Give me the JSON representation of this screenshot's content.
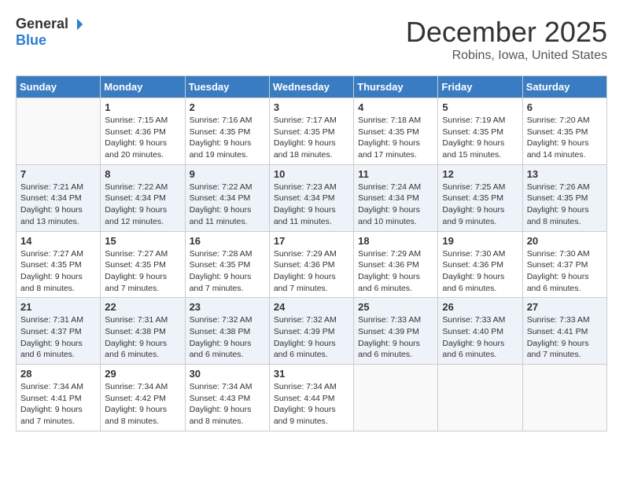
{
  "header": {
    "logo_general": "General",
    "logo_blue": "Blue",
    "month_title": "December 2025",
    "subtitle": "Robins, Iowa, United States"
  },
  "days_of_week": [
    "Sunday",
    "Monday",
    "Tuesday",
    "Wednesday",
    "Thursday",
    "Friday",
    "Saturday"
  ],
  "weeks": [
    [
      {
        "day": "",
        "empty": true
      },
      {
        "day": "1",
        "sunrise": "Sunrise: 7:15 AM",
        "sunset": "Sunset: 4:36 PM",
        "daylight": "Daylight: 9 hours and 20 minutes."
      },
      {
        "day": "2",
        "sunrise": "Sunrise: 7:16 AM",
        "sunset": "Sunset: 4:35 PM",
        "daylight": "Daylight: 9 hours and 19 minutes."
      },
      {
        "day": "3",
        "sunrise": "Sunrise: 7:17 AM",
        "sunset": "Sunset: 4:35 PM",
        "daylight": "Daylight: 9 hours and 18 minutes."
      },
      {
        "day": "4",
        "sunrise": "Sunrise: 7:18 AM",
        "sunset": "Sunset: 4:35 PM",
        "daylight": "Daylight: 9 hours and 17 minutes."
      },
      {
        "day": "5",
        "sunrise": "Sunrise: 7:19 AM",
        "sunset": "Sunset: 4:35 PM",
        "daylight": "Daylight: 9 hours and 15 minutes."
      },
      {
        "day": "6",
        "sunrise": "Sunrise: 7:20 AM",
        "sunset": "Sunset: 4:35 PM",
        "daylight": "Daylight: 9 hours and 14 minutes."
      }
    ],
    [
      {
        "day": "7",
        "sunrise": "Sunrise: 7:21 AM",
        "sunset": "Sunset: 4:34 PM",
        "daylight": "Daylight: 9 hours and 13 minutes."
      },
      {
        "day": "8",
        "sunrise": "Sunrise: 7:22 AM",
        "sunset": "Sunset: 4:34 PM",
        "daylight": "Daylight: 9 hours and 12 minutes."
      },
      {
        "day": "9",
        "sunrise": "Sunrise: 7:22 AM",
        "sunset": "Sunset: 4:34 PM",
        "daylight": "Daylight: 9 hours and 11 minutes."
      },
      {
        "day": "10",
        "sunrise": "Sunrise: 7:23 AM",
        "sunset": "Sunset: 4:34 PM",
        "daylight": "Daylight: 9 hours and 11 minutes."
      },
      {
        "day": "11",
        "sunrise": "Sunrise: 7:24 AM",
        "sunset": "Sunset: 4:34 PM",
        "daylight": "Daylight: 9 hours and 10 minutes."
      },
      {
        "day": "12",
        "sunrise": "Sunrise: 7:25 AM",
        "sunset": "Sunset: 4:35 PM",
        "daylight": "Daylight: 9 hours and 9 minutes."
      },
      {
        "day": "13",
        "sunrise": "Sunrise: 7:26 AM",
        "sunset": "Sunset: 4:35 PM",
        "daylight": "Daylight: 9 hours and 8 minutes."
      }
    ],
    [
      {
        "day": "14",
        "sunrise": "Sunrise: 7:27 AM",
        "sunset": "Sunset: 4:35 PM",
        "daylight": "Daylight: 9 hours and 8 minutes."
      },
      {
        "day": "15",
        "sunrise": "Sunrise: 7:27 AM",
        "sunset": "Sunset: 4:35 PM",
        "daylight": "Daylight: 9 hours and 7 minutes."
      },
      {
        "day": "16",
        "sunrise": "Sunrise: 7:28 AM",
        "sunset": "Sunset: 4:35 PM",
        "daylight": "Daylight: 9 hours and 7 minutes."
      },
      {
        "day": "17",
        "sunrise": "Sunrise: 7:29 AM",
        "sunset": "Sunset: 4:36 PM",
        "daylight": "Daylight: 9 hours and 7 minutes."
      },
      {
        "day": "18",
        "sunrise": "Sunrise: 7:29 AM",
        "sunset": "Sunset: 4:36 PM",
        "daylight": "Daylight: 9 hours and 6 minutes."
      },
      {
        "day": "19",
        "sunrise": "Sunrise: 7:30 AM",
        "sunset": "Sunset: 4:36 PM",
        "daylight": "Daylight: 9 hours and 6 minutes."
      },
      {
        "day": "20",
        "sunrise": "Sunrise: 7:30 AM",
        "sunset": "Sunset: 4:37 PM",
        "daylight": "Daylight: 9 hours and 6 minutes."
      }
    ],
    [
      {
        "day": "21",
        "sunrise": "Sunrise: 7:31 AM",
        "sunset": "Sunset: 4:37 PM",
        "daylight": "Daylight: 9 hours and 6 minutes."
      },
      {
        "day": "22",
        "sunrise": "Sunrise: 7:31 AM",
        "sunset": "Sunset: 4:38 PM",
        "daylight": "Daylight: 9 hours and 6 minutes."
      },
      {
        "day": "23",
        "sunrise": "Sunrise: 7:32 AM",
        "sunset": "Sunset: 4:38 PM",
        "daylight": "Daylight: 9 hours and 6 minutes."
      },
      {
        "day": "24",
        "sunrise": "Sunrise: 7:32 AM",
        "sunset": "Sunset: 4:39 PM",
        "daylight": "Daylight: 9 hours and 6 minutes."
      },
      {
        "day": "25",
        "sunrise": "Sunrise: 7:33 AM",
        "sunset": "Sunset: 4:39 PM",
        "daylight": "Daylight: 9 hours and 6 minutes."
      },
      {
        "day": "26",
        "sunrise": "Sunrise: 7:33 AM",
        "sunset": "Sunset: 4:40 PM",
        "daylight": "Daylight: 9 hours and 6 minutes."
      },
      {
        "day": "27",
        "sunrise": "Sunrise: 7:33 AM",
        "sunset": "Sunset: 4:41 PM",
        "daylight": "Daylight: 9 hours and 7 minutes."
      }
    ],
    [
      {
        "day": "28",
        "sunrise": "Sunrise: 7:34 AM",
        "sunset": "Sunset: 4:41 PM",
        "daylight": "Daylight: 9 hours and 7 minutes."
      },
      {
        "day": "29",
        "sunrise": "Sunrise: 7:34 AM",
        "sunset": "Sunset: 4:42 PM",
        "daylight": "Daylight: 9 hours and 8 minutes."
      },
      {
        "day": "30",
        "sunrise": "Sunrise: 7:34 AM",
        "sunset": "Sunset: 4:43 PM",
        "daylight": "Daylight: 9 hours and 8 minutes."
      },
      {
        "day": "31",
        "sunrise": "Sunrise: 7:34 AM",
        "sunset": "Sunset: 4:44 PM",
        "daylight": "Daylight: 9 hours and 9 minutes."
      },
      {
        "day": "",
        "empty": true
      },
      {
        "day": "",
        "empty": true
      },
      {
        "day": "",
        "empty": true
      }
    ]
  ]
}
